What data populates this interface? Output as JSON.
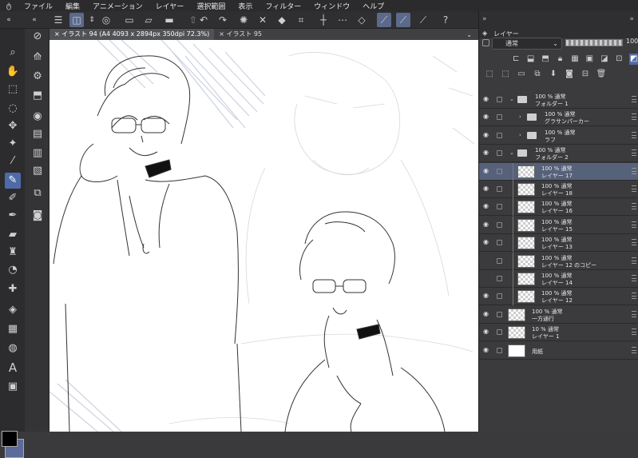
{
  "menu": [
    "ファイル",
    "編集",
    "アニメーション",
    "レイヤー",
    "選択範囲",
    "表示",
    "フィルター",
    "ウィンドウ",
    "ヘルプ"
  ],
  "tabs": [
    {
      "label": "イラスト 94 (A4 4093 x 2894px 350dpi 72.3%)"
    },
    {
      "label": "イラスト 95"
    }
  ],
  "panel": {
    "tab_label": "レイヤー",
    "blend_mode": "通常",
    "opacity": "100"
  },
  "layers": [
    {
      "id": "folder1",
      "line1": "100 % 通常",
      "line2": "フォルダー 1",
      "type": "folder",
      "indent": 0,
      "open": true,
      "selected": false,
      "visible": true
    },
    {
      "id": "grasan",
      "line1": "100 % 通常",
      "line2": "グラサンパーカー",
      "type": "folder",
      "indent": 1,
      "open": false,
      "selected": false,
      "visible": true
    },
    {
      "id": "rough",
      "line1": "100 % 通常",
      "line2": "ラフ",
      "type": "folder",
      "indent": 1,
      "open": false,
      "selected": false,
      "visible": true
    },
    {
      "id": "folder2",
      "line1": "100 % 通常",
      "line2": "フォルダー 2",
      "type": "folder",
      "indent": 0,
      "open": true,
      "selected": false,
      "visible": true
    },
    {
      "id": "l17",
      "line1": "100 % 通常",
      "line2": "レイヤー 17",
      "type": "raster",
      "indent": 1,
      "selected": true,
      "visible": true
    },
    {
      "id": "l18",
      "line1": "100 % 通常",
      "line2": "レイヤー 18",
      "type": "raster",
      "indent": 1,
      "selected": false,
      "visible": true
    },
    {
      "id": "l16",
      "line1": "100 % 通常",
      "line2": "レイヤー 16",
      "type": "raster",
      "indent": 1,
      "selected": false,
      "visible": true
    },
    {
      "id": "l15",
      "line1": "100 % 通常",
      "line2": "レイヤー 15",
      "type": "raster",
      "indent": 1,
      "selected": false,
      "visible": true
    },
    {
      "id": "l13",
      "line1": "100 % 通常",
      "line2": "レイヤー 13",
      "type": "raster",
      "indent": 1,
      "selected": false,
      "visible": true
    },
    {
      "id": "l12c",
      "line1": "100 % 通常",
      "line2": "レイヤー 12 のコピー",
      "type": "raster",
      "indent": 1,
      "selected": false,
      "visible": false
    },
    {
      "id": "l14",
      "line1": "100 % 通常",
      "line2": "レイヤー 14",
      "type": "raster",
      "indent": 1,
      "selected": false,
      "visible": false
    },
    {
      "id": "l12",
      "line1": "100 % 通常",
      "line2": "レイヤー 12",
      "type": "raster",
      "indent": 1,
      "selected": false,
      "visible": true
    },
    {
      "id": "oneway",
      "line1": "100 % 通常",
      "line2": "一方通行",
      "type": "raster",
      "indent": 0,
      "selected": false,
      "visible": true
    },
    {
      "id": "l1",
      "line1": "10 % 通常",
      "line2": "レイヤー 1",
      "type": "raster",
      "indent": 0,
      "selected": false,
      "visible": true
    },
    {
      "id": "paper",
      "line1": "",
      "line2": "用紙",
      "type": "paper",
      "indent": 0,
      "selected": false,
      "visible": true
    }
  ],
  "colors": {
    "accent": "#4f6aa8",
    "selected_layer": "#56617a",
    "main_color": "#000000",
    "sub_color": "#5d6a9a"
  }
}
